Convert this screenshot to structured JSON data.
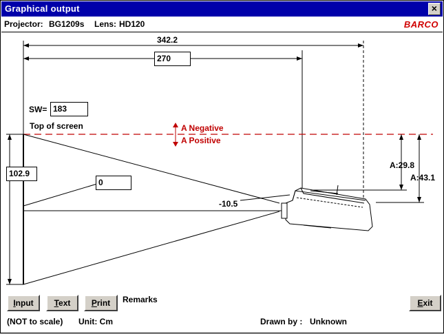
{
  "window": {
    "title": "Graphical output",
    "close_glyph": "×"
  },
  "header": {
    "projector_label": "Projector:",
    "projector_value": "BG1209s",
    "lens_label": "Lens:",
    "lens_value": "HD120",
    "logo": "BARCO",
    "logo_color": "#d00000"
  },
  "diagram": {
    "total_distance": "342.2",
    "throw_distance": "270",
    "sw_label": "SW=",
    "sw_value": "183",
    "top_of_screen": "Top of screen",
    "a_negative": "A Negative",
    "a_positive": "A Positive",
    "screen_height": "102.9",
    "tilt_value": "0",
    "offset_value": "-10.5",
    "a_inner": "A:29.8",
    "a_outer": "A:43.1",
    "accent_red": "#c00000"
  },
  "buttons": {
    "input_first": "I",
    "input_rest": "nput",
    "text_first": "T",
    "text_rest": "ext",
    "print_first": "P",
    "print_rest": "rint",
    "exit_first": "E",
    "exit_rest": "xit"
  },
  "remarks_label": "Remarks",
  "footer": {
    "scale_note": "(NOT to scale)",
    "unit": "Unit: Cm",
    "drawn_by_label": "Drawn by :",
    "drawn_by_value": "Unknown"
  }
}
